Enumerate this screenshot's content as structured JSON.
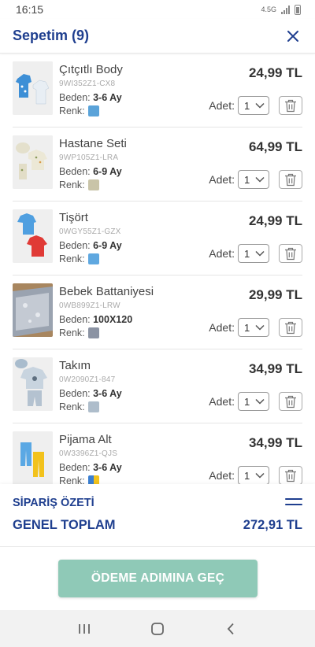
{
  "status_bar": {
    "time": "16:15",
    "network": "4.5G"
  },
  "header": {
    "title": "Sepetim (9)"
  },
  "labels": {
    "size": "Beden:",
    "color": "Renk:",
    "qty": "Adet:"
  },
  "items": [
    {
      "name": "Çıtçıtlı Body",
      "code": "9WI352Z1-CX8",
      "size": "3-6 Ay",
      "price": "24,99 TL",
      "qty": "1",
      "swatch_color": "#5aa3d9"
    },
    {
      "name": "Hastane Seti",
      "code": "9WP105Z1-LRA",
      "size": "6-9 Ay",
      "price": "64,99 TL",
      "qty": "1",
      "swatch_color": "#c9c4a8"
    },
    {
      "name": "Tişört",
      "code": "0WGY55Z1-GZX",
      "size": "6-9 Ay",
      "price": "24,99 TL",
      "qty": "1",
      "swatch_color": "#5fa8e0"
    },
    {
      "name": "Bebek Battaniyesi",
      "code": "0WB899Z1-LRW",
      "size": "100X120",
      "price": "29,99 TL",
      "qty": "1",
      "swatch_color": "#8b93a3"
    },
    {
      "name": "Takım",
      "code": "0W2090Z1-847",
      "size": "3-6 Ay",
      "price": "34,99 TL",
      "qty": "1",
      "swatch_color": "#aebdcb"
    },
    {
      "name": "Pijama Alt",
      "code": "0W3396Z1-QJS",
      "size": "3-6 Ay",
      "price": "34,99 TL",
      "qty": "1",
      "swatch_color": "#3b7fd1"
    }
  ],
  "summary": {
    "title": "SİPARİŞ ÖZETİ",
    "total_label": "GENEL TOPLAM",
    "total_value": "272,91 TL"
  },
  "checkout": {
    "label": "ÖDEME ADIMINA GEÇ"
  },
  "colors": {
    "brand_blue": "#1f3f8f",
    "checkout_green": "#8fc9b7"
  }
}
